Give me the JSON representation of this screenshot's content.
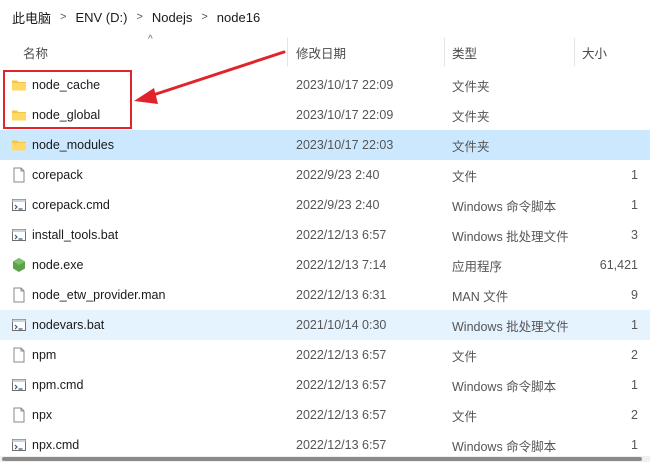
{
  "breadcrumb": [
    {
      "label": "此电脑"
    },
    {
      "label": "ENV (D:)"
    },
    {
      "label": "Nodejs"
    },
    {
      "label": "node16"
    }
  ],
  "columns": {
    "name": "名称",
    "date": "修改日期",
    "type": "类型",
    "size": "大小"
  },
  "sort_indicator": "^",
  "files": [
    {
      "name": "node_cache",
      "date": "2023/10/17 22:09",
      "type": "文件夹",
      "size": "",
      "icon": "folder-icon"
    },
    {
      "name": "node_global",
      "date": "2023/10/17 22:09",
      "type": "文件夹",
      "size": "",
      "icon": "folder-icon"
    },
    {
      "name": "node_modules",
      "date": "2023/10/17 22:03",
      "type": "文件夹",
      "size": "",
      "icon": "folder-icon"
    },
    {
      "name": "corepack",
      "date": "2022/9/23 2:40",
      "type": "文件",
      "size": "1",
      "icon": "file-icon"
    },
    {
      "name": "corepack.cmd",
      "date": "2022/9/23 2:40",
      "type": "Windows 命令脚本",
      "size": "1",
      "icon": "script-icon"
    },
    {
      "name": "install_tools.bat",
      "date": "2022/12/13 6:57",
      "type": "Windows 批处理文件",
      "size": "3",
      "icon": "script-icon"
    },
    {
      "name": "node.exe",
      "date": "2022/12/13 7:14",
      "type": "应用程序",
      "size": "61,421",
      "icon": "node-exe-icon"
    },
    {
      "name": "node_etw_provider.man",
      "date": "2022/12/13 6:31",
      "type": "MAN 文件",
      "size": "9",
      "icon": "file-icon"
    },
    {
      "name": "nodevars.bat",
      "date": "2021/10/14 0:30",
      "type": "Windows 批处理文件",
      "size": "1",
      "icon": "script-icon"
    },
    {
      "name": "npm",
      "date": "2022/12/13 6:57",
      "type": "文件",
      "size": "2",
      "icon": "file-icon"
    },
    {
      "name": "npm.cmd",
      "date": "2022/12/13 6:57",
      "type": "Windows 命令脚本",
      "size": "1",
      "icon": "script-icon"
    },
    {
      "name": "npx",
      "date": "2022/12/13 6:57",
      "type": "文件",
      "size": "2",
      "icon": "file-icon"
    },
    {
      "name": "npx.cmd",
      "date": "2022/12/13 6:57",
      "type": "Windows 命令脚本",
      "size": "1",
      "icon": "script-icon"
    }
  ],
  "selected_file": "node_modules",
  "hovered_file": "nodevars.bat",
  "colors": {
    "selected_row": "#cce8ff",
    "hover_row": "#e5f3ff",
    "annotation_red": "#e0242a",
    "folder_yellow": "#f4c542",
    "node_green": "#5fa04e"
  }
}
